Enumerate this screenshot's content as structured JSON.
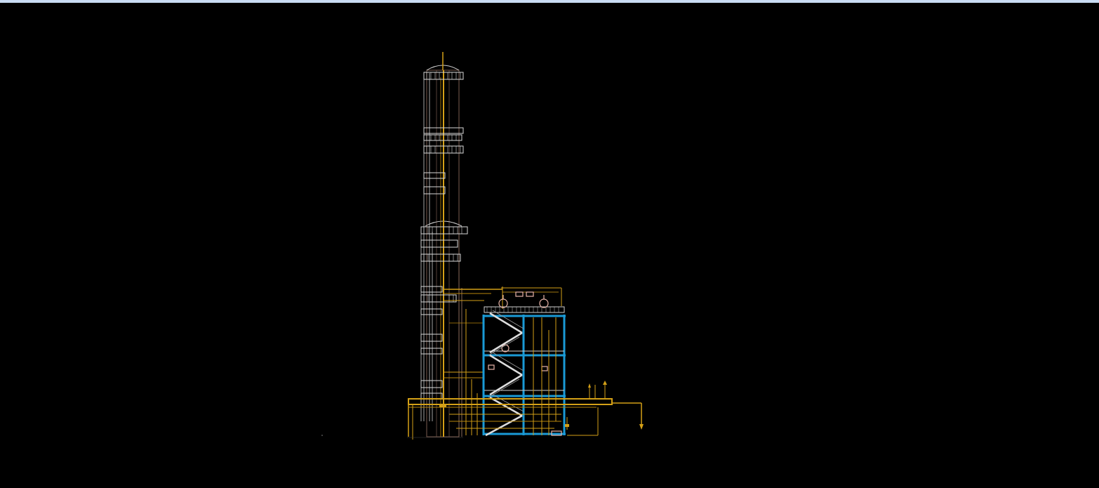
{
  "viewport": {
    "background": "#000000",
    "window_strip_color": "#c9dcf3"
  },
  "drawing": {
    "colors": {
      "steel_structure": "#1a9ad6",
      "piping_yellow": "#d4a017",
      "piping_orange": "#b8860b",
      "ladders_platforms": "#cfcfcf",
      "column_shell": "#8a6a5a",
      "equipment_pink": "#e8b4a8"
    },
    "components": [
      "distillation-column",
      "steel-structure",
      "stairway",
      "pipe-rack",
      "platforms",
      "vessels"
    ]
  }
}
